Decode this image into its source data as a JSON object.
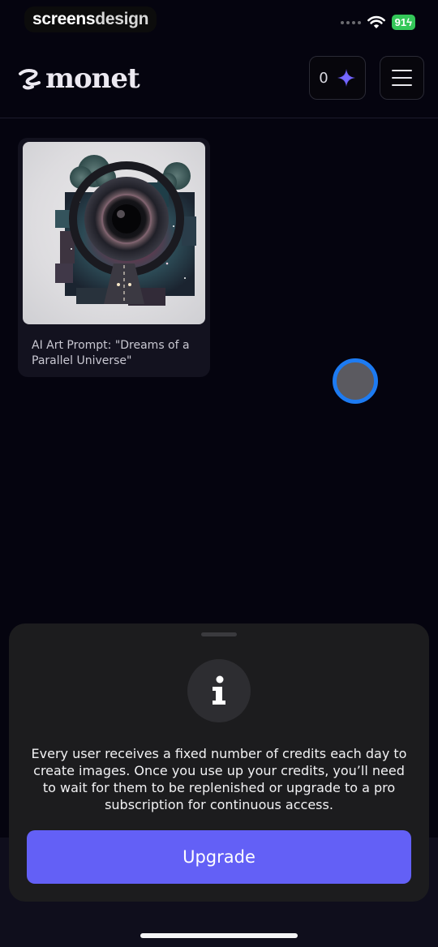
{
  "status_bar": {
    "watermark_part1": "screens",
    "watermark_part2": "design",
    "battery": "91"
  },
  "header": {
    "logo_text": "monet",
    "credits_count": "0",
    "credits_icon": "diamond-sparkle-icon",
    "menu_icon": "hamburger-menu-icon"
  },
  "gallery": {
    "items": [
      {
        "caption": "AI Art Prompt: \"Dreams of a Parallel Universe\""
      }
    ]
  },
  "info_sheet": {
    "icon": "info-icon",
    "message": "Every user receives a fixed number of credits each day to create images. Once you use up your credits, you’ll need to wait for them to be replenished or upgrade to a pro subscription for continuous access.",
    "upgrade_label": "Upgrade"
  },
  "colors": {
    "background": "#05040f",
    "accent": "#6360f6",
    "sheet": "#1c1c1e"
  }
}
